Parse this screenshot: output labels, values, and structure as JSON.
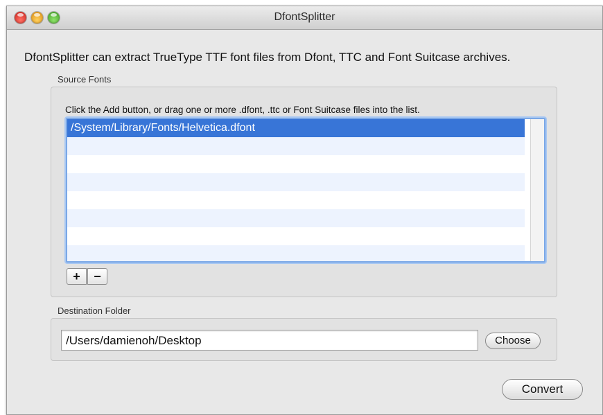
{
  "window": {
    "title": "DfontSplitter"
  },
  "description": "DfontSplitter can extract TrueType TTF font files from Dfont, TTC and Font Suitcase archives.",
  "source_fonts": {
    "label": "Source Fonts",
    "hint": "Click the Add button, or drag one or more .dfont, .ttc or Font Suitcase files into the list.",
    "items": [
      "/System/Library/Fonts/Helvetica.dfont"
    ],
    "add_label": "+",
    "remove_label": "−"
  },
  "destination": {
    "label": "Destination Folder",
    "path": "/Users/damienoh/Desktop",
    "choose_label": "Choose"
  },
  "convert_label": "Convert",
  "colors": {
    "selection": "#3875d7",
    "alt_row": "#edf3fe",
    "close": "#e0443e",
    "minimize": "#f5b133",
    "zoom": "#5fc33b"
  }
}
